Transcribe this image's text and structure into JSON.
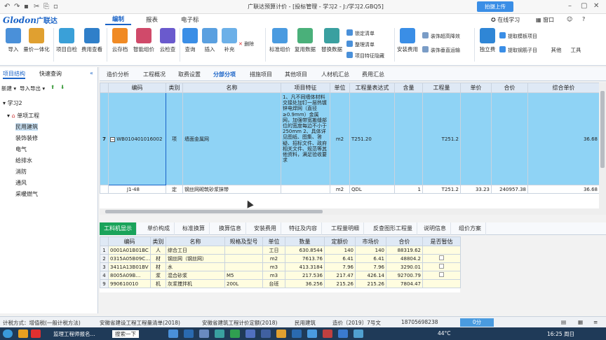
{
  "window": {
    "title": "广联达预算计价 - [投标管理 - 学习2 - J:/学习2.GBQ5]",
    "login_button": "拍摄上传",
    "online_learning": "在线学习",
    "window_menu": "窗口"
  },
  "menu": {
    "logo": "Glodon",
    "logo_cn": "广联达",
    "tabs": [
      "编制",
      "报表",
      "电子标"
    ],
    "active_tab": "编制"
  },
  "ribbon": {
    "buttons": [
      "导入",
      "量价一体化",
      "项目自检",
      "费用查看",
      "云存档",
      "智能组价",
      "云检查",
      "查询",
      "插入",
      "补充",
      "删除",
      "标准组价",
      "复用数据",
      "替换数据",
      "安装费用",
      "独立费",
      "其他",
      "工具"
    ],
    "small_items": [
      "锁定清单",
      "整理清单",
      "项目特征隐藏",
      "装饰超高降效",
      "装饰垂直运输",
      "提取模板项目",
      "提取钢筋子目"
    ]
  },
  "left_panel": {
    "tabs": [
      "项目结构",
      "快速查询"
    ],
    "toolbar": [
      "新建",
      "导入导出"
    ],
    "tree": [
      "学习2",
      "单项工程",
      "民用建筑",
      "装饰装修",
      "电气",
      "给排水",
      "消防",
      "通风",
      "采暖燃气"
    ],
    "selected": "民用建筑"
  },
  "main_tabs": [
    "造价分析",
    "工程概况",
    "取费设置",
    "分部分项",
    "措施项目",
    "其他项目",
    "人材机汇总",
    "费用汇总"
  ],
  "active_main_tab": "分部分项",
  "upper_grid": {
    "headers": [
      "",
      "编码",
      "类别",
      "名称",
      "项目特征",
      "单位",
      "工程量表达式",
      "含量",
      "工程量",
      "单价",
      "合价",
      "综合单价"
    ],
    "rows": [
      {
        "no": "7",
        "code": "WB010401016002",
        "category": "项",
        "name": "墙面金属网",
        "feature": "1、凡不同墙体材料交接处加钉一层热镀锌电焊网（直径≥0.9mm）金属网，加强带宽搬缝部位的宽度每边不小于250mm 2、具体详见图纸、图集、答疑、招标文件、政府相关文件、规范等其他资料，满足验收要求",
        "unit": "m2",
        "expr": "T251.20",
        "content": "",
        "qty": "T251.2",
        "price": "",
        "total": "",
        "comp_price": "36.68"
      },
      {
        "no": "",
        "code": "J1-48",
        "category": "定",
        "name": "钢丝网砌筑砂浆抹带",
        "feature": "",
        "unit": "m2",
        "expr": "QDL",
        "content": "1",
        "qty": "T251.2",
        "price": "33.23",
        "total": "240957.38",
        "comp_price": "36.68"
      }
    ]
  },
  "lower_tabs": [
    "工料机显示",
    "单价构成",
    "标准换算",
    "换算信息",
    "安装费用",
    "特征及内容",
    "工程量明细",
    "反查图形工程量",
    "说明信息",
    "组价方案"
  ],
  "active_lower_tab": "工料机显示",
  "lower_grid": {
    "headers": [
      "",
      "编码",
      "类别",
      "名称",
      "规格及型号",
      "单位",
      "数量",
      "定额价",
      "市场价",
      "合价",
      "是否暂估"
    ],
    "rows": [
      {
        "no": "1",
        "code": "0001A01B01BC",
        "cat": "人",
        "name": "综合工日",
        "spec": "",
        "unit": "工日",
        "qty": "630.8544",
        "quota": "140",
        "market": "140",
        "total": "88319.62",
        "est": false
      },
      {
        "no": "2",
        "code": "0315A05B09C…",
        "cat": "材",
        "name": "钢丝网（钢丝网）",
        "spec": "",
        "unit": "m2",
        "qty": "7613.76",
        "quota": "6.41",
        "market": "6.41",
        "total": "48804.2",
        "est": true
      },
      {
        "no": "3",
        "code": "3411A13B01BV",
        "cat": "材",
        "name": "水",
        "spec": "",
        "unit": "m3",
        "qty": "413.3184",
        "quota": "7.96",
        "market": "7.96",
        "total": "3290.01",
        "est": true
      },
      {
        "no": "4",
        "code": "8005A09B…",
        "cat": "浆",
        "name": "混合砂浆",
        "spec": "M5",
        "unit": "m3",
        "qty": "217.536",
        "quota": "217.47",
        "market": "426.14",
        "total": "92700.79",
        "est": true
      },
      {
        "no": "9",
        "code": "990610010",
        "cat": "机",
        "name": "灰浆搅拌机",
        "spec": "200L",
        "unit": "台班",
        "qty": "36.256",
        "quota": "215.26",
        "market": "215.26",
        "total": "7804.47",
        "est": false
      }
    ]
  },
  "status": {
    "tax_mode": "计税方式：增值税(一般计税方法)",
    "list_std": "安徽省建设工程工程量清单(2018)",
    "quota_std": "安徽省建筑工程计价定额(2018)",
    "building": "民用建筑",
    "price_doc": "造价〔2019〕7号文",
    "phone": "18705698238",
    "zoom": "0分"
  },
  "taskbar": {
    "items": [
      "监理工程师报名...",
      "搜索一下"
    ],
    "temp": "44°C",
    "time": "16:25 周日"
  },
  "colors": {
    "accent": "#1a63c7",
    "row_highlight": "#8fd3f5",
    "active_lower_tab": "#1aa35a"
  }
}
